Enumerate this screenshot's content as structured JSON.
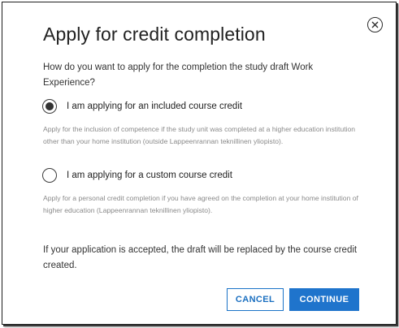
{
  "dialog": {
    "title": "Apply for credit completion",
    "question": "How do you want to apply for the completion the study draft Work Experience?",
    "options": [
      {
        "label": "I am applying for an included course credit",
        "selected": true,
        "description": "Apply for the inclusion of competence if the study unit was completed at a higher education institution other than your home institution (outside Lappeenrannan teknillinen yliopisto)."
      },
      {
        "label": "I am applying for a custom course credit",
        "selected": false,
        "description": "Apply for a personal credit completion if you have agreed on the completion at your home institution of higher education (Lappeenrannan teknillinen yliopisto)."
      }
    ],
    "note": "If your application is accepted, the draft will be replaced by the course credit created.",
    "buttons": {
      "cancel_label": "CANCEL",
      "continue_label": "CONTINUE"
    },
    "close_icon": "close-circle-icon"
  },
  "colors": {
    "accent": "#1f74cc",
    "title": "#222222",
    "muted": "#8a8a8a",
    "radio_fill": "#333333"
  }
}
